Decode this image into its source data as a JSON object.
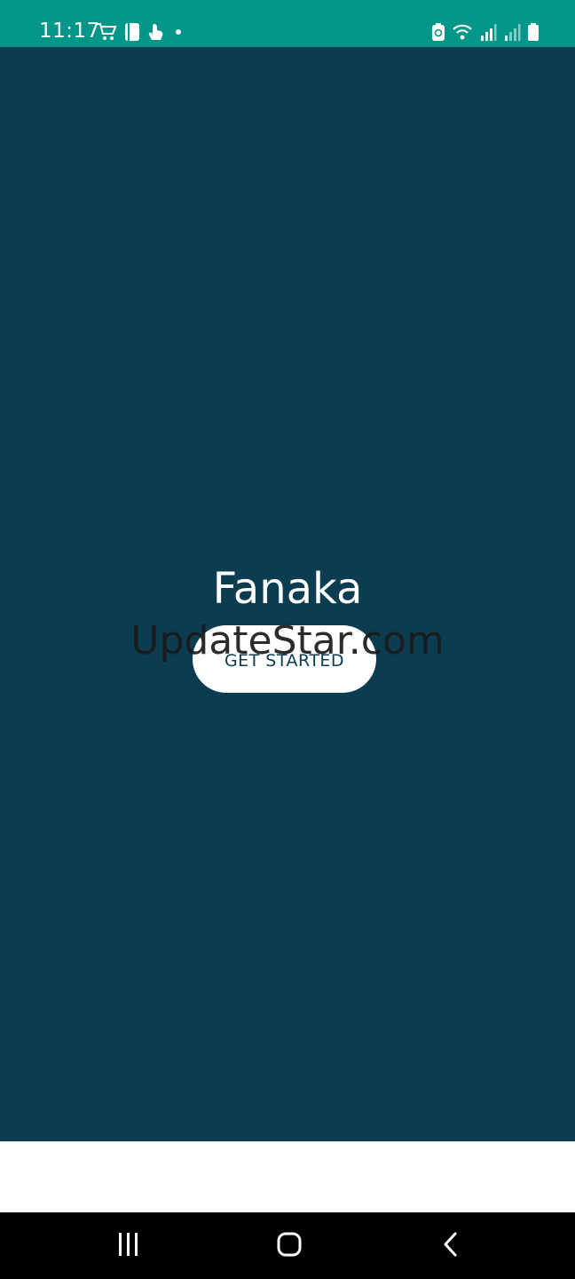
{
  "status_bar": {
    "time": "11:17",
    "left_icons": [
      "shopping-cart-icon",
      "notes-icon",
      "hand-icon",
      "dot-icon"
    ],
    "right_icons": [
      "battery-saver-icon",
      "wifi-icon",
      "signal-1-icon",
      "signal-2-icon",
      "battery-icon"
    ],
    "background": "#009688"
  },
  "main": {
    "background": "#0b3c4f",
    "title": "Fanaka",
    "get_started_label": "GET STARTED"
  },
  "watermark": "UpdateStar.com",
  "nav_bar": {
    "buttons": [
      "recent-apps",
      "home",
      "back"
    ]
  }
}
